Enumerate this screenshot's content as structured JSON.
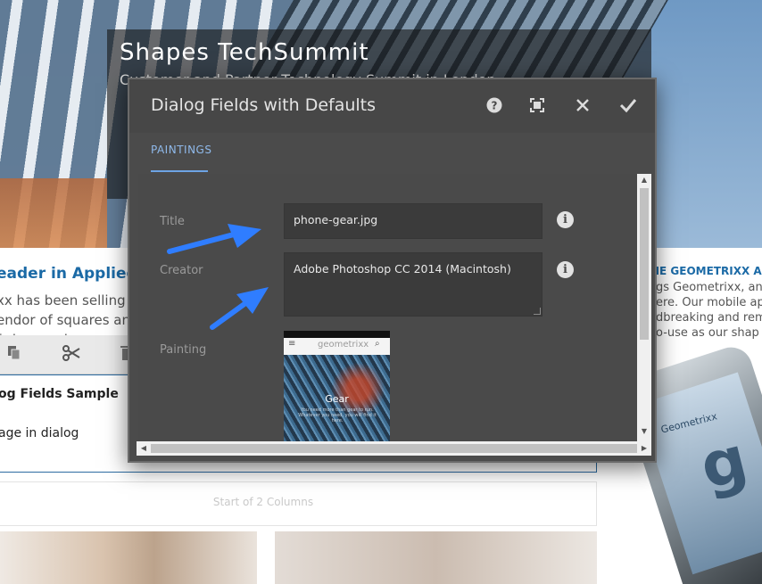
{
  "page": {
    "site_title": "Shapes TechSummit",
    "site_subtitle": "Customer and Partner Technology Summit in London",
    "left_heading": "eader in Applied",
    "left_paragraph": [
      "xx has been selling",
      "endor of squares an",
      "f shapes since"
    ],
    "right_heading": "HE GEOMETRIXX A",
    "right_paragraph": [
      "gs Geometrixx, an",
      "ere. Our mobile ap",
      "dbreaking and rem",
      "o-use as our shap"
    ],
    "phone_label": "Geometrixx",
    "phone_letter": "g",
    "component_title": "og Fields Sample",
    "component_text": "age in dialog",
    "columns_label": "Start of 2 Columns"
  },
  "editor_toolbar": {
    "icons": [
      "copy-icon",
      "cut-icon",
      "delete-icon"
    ]
  },
  "dialog": {
    "title": "Dialog Fields with Defaults",
    "header_buttons": [
      "help-icon",
      "fullscreen-icon",
      "close-icon",
      "done-icon"
    ],
    "tab": "PAINTINGS",
    "fields": {
      "title_label": "Title",
      "title_value": "phone-gear.jpg",
      "creator_label": "Creator",
      "creator_value": "Adobe Photoshop CC 2014 (Macintosh)",
      "painting_label": "Painting"
    },
    "thumbnail": {
      "brand": "geometrixx",
      "caption": "Gear",
      "subcaption": "You need more than gear to run. Whatever you need, you will find it here."
    }
  },
  "colors": {
    "dialog_bg": "#4b4b4b",
    "tab_accent": "#6da4e4",
    "link_blue": "#1b6aa6",
    "annotation_arrow": "#2f7dff"
  }
}
